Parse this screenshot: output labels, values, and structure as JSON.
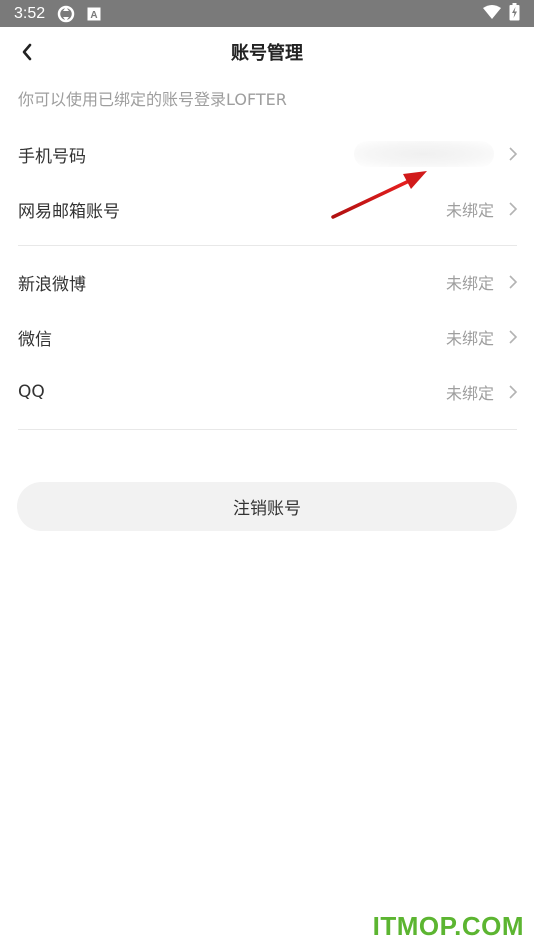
{
  "status_bar": {
    "time": "3:52",
    "icons": [
      "sync-icon",
      "a-badge-icon",
      "wifi-icon",
      "battery-charging-icon"
    ]
  },
  "header": {
    "title": "账号管理",
    "back_icon": "chevron-left-icon"
  },
  "subtitle": "你可以使用已绑定的账号登录LOFTER",
  "accounts_group1": [
    {
      "label": "手机号码",
      "status": ""
    },
    {
      "label": "网易邮箱账号",
      "status": "未绑定"
    }
  ],
  "accounts_group2": [
    {
      "label": "新浪微博",
      "status": "未绑定"
    },
    {
      "label": "微信",
      "status": "未绑定"
    },
    {
      "label": "QQ",
      "status": "未绑定"
    }
  ],
  "logout_label": "注销账号",
  "watermark": "ITMOP.COM",
  "colors": {
    "status_bar_bg": "#7a7a7a",
    "annotation_arrow": "#d11a1a",
    "watermark": "#5cb531",
    "muted_text": "#9e9e9e"
  }
}
